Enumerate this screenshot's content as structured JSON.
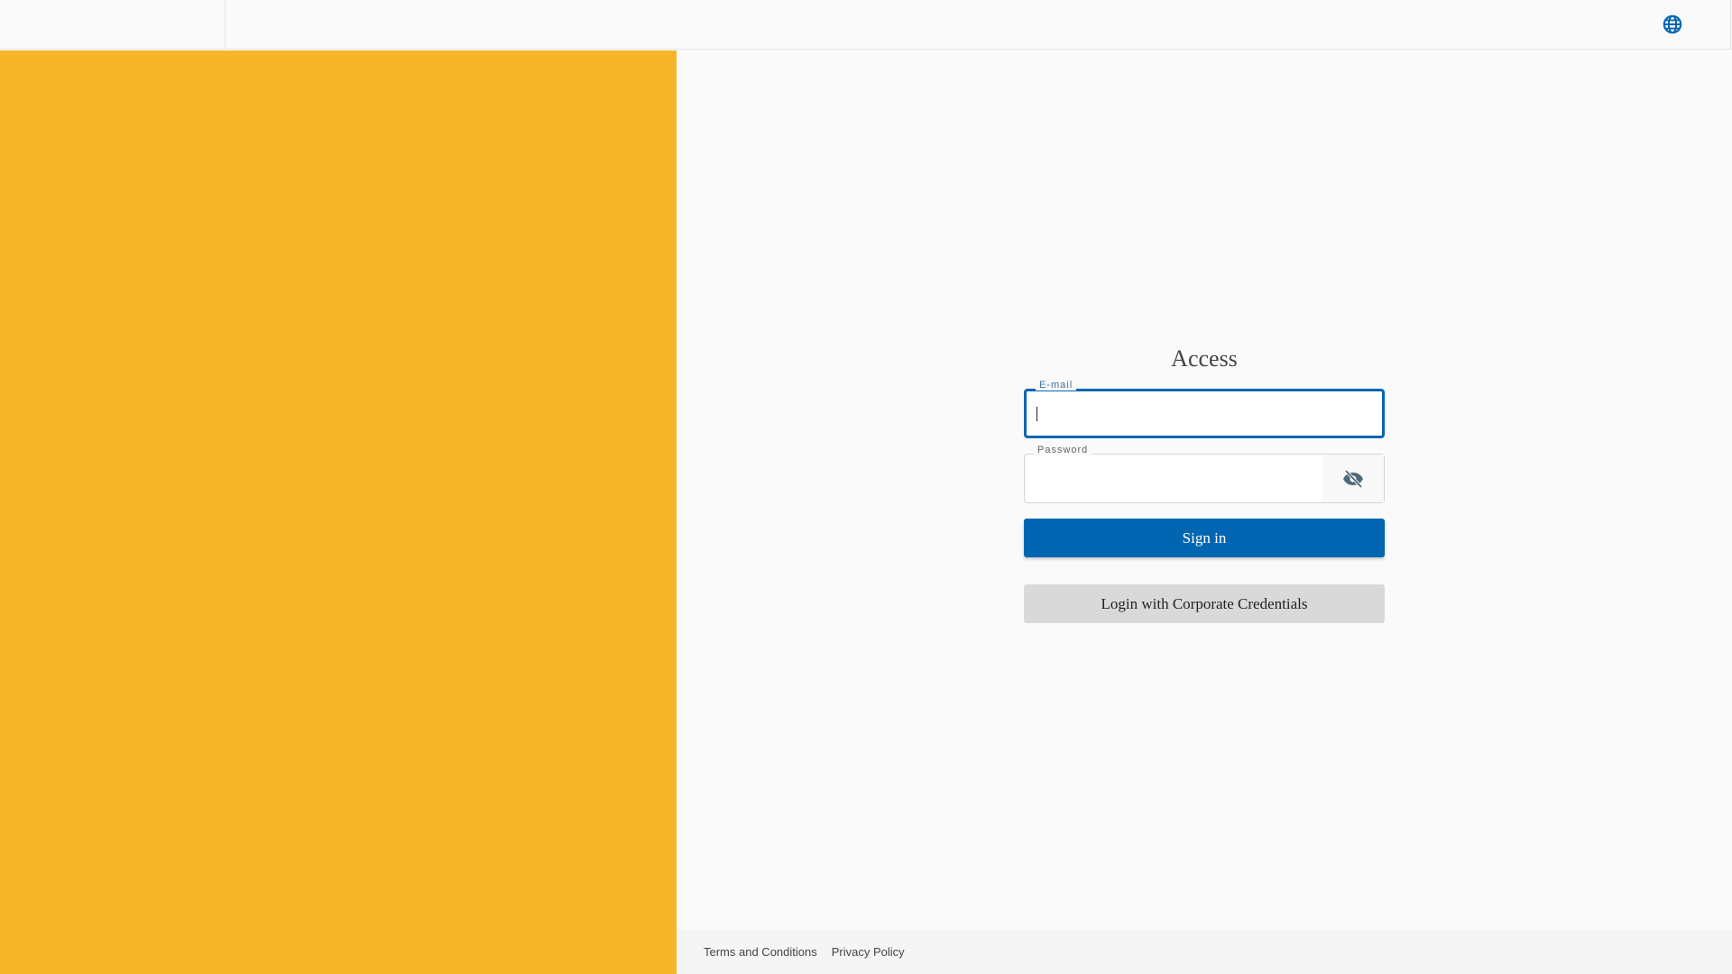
{
  "header": {
    "language_icon": "globe-icon"
  },
  "login": {
    "title": "Access",
    "email_label": "E-mail",
    "email_value": "",
    "password_label": "Password",
    "password_value": "",
    "toggle_icon": "eye-off-icon",
    "signin_label": "Sign in",
    "corporate_label": "Login with Corporate Credentials"
  },
  "footer": {
    "terms": "Terms and Conditions",
    "privacy": "Privacy Policy"
  },
  "colors": {
    "accent": "#0066b2",
    "panel": "#f7b62a"
  }
}
